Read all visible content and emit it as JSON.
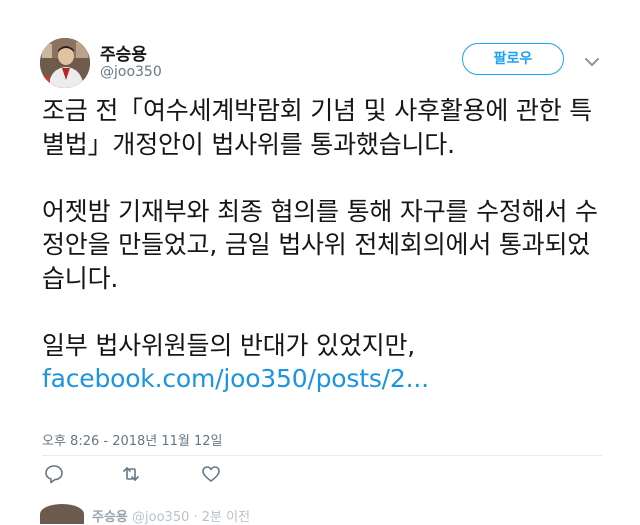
{
  "author": {
    "display_name": "주승용",
    "handle": "@joo350"
  },
  "follow_button_label": "팔로우",
  "tweet": {
    "paragraphs": [
      "조금 전「여수세계박람회 기념 및 사후활용에 관한 특별법」개정안이 법사위를 통과했습니다.",
      "어젯밤 기재부와 최종 협의를 통해 자구를 수정해서 수정안을 만들었고, 금일 법사위 전체회의에서 통과되었습니다.",
      "일부 법사위원들의 반대가 있었지만,"
    ],
    "link_text": "facebook.com/joo350/posts/2...",
    "timestamp": "오후 8:26 - 2018년 11월 12일"
  },
  "actions": {
    "reply_icon": "reply-icon",
    "retweet_icon": "retweet-icon",
    "like_icon": "heart-icon"
  },
  "next_tweet": {
    "display_name": "주승용",
    "handle_partial": "@joo350 · 2분 이전"
  },
  "colors": {
    "accent": "#1da1f2",
    "link": "#1b95e0",
    "text": "#14171a",
    "secondary": "#657786",
    "divider": "#e6ecf0"
  }
}
